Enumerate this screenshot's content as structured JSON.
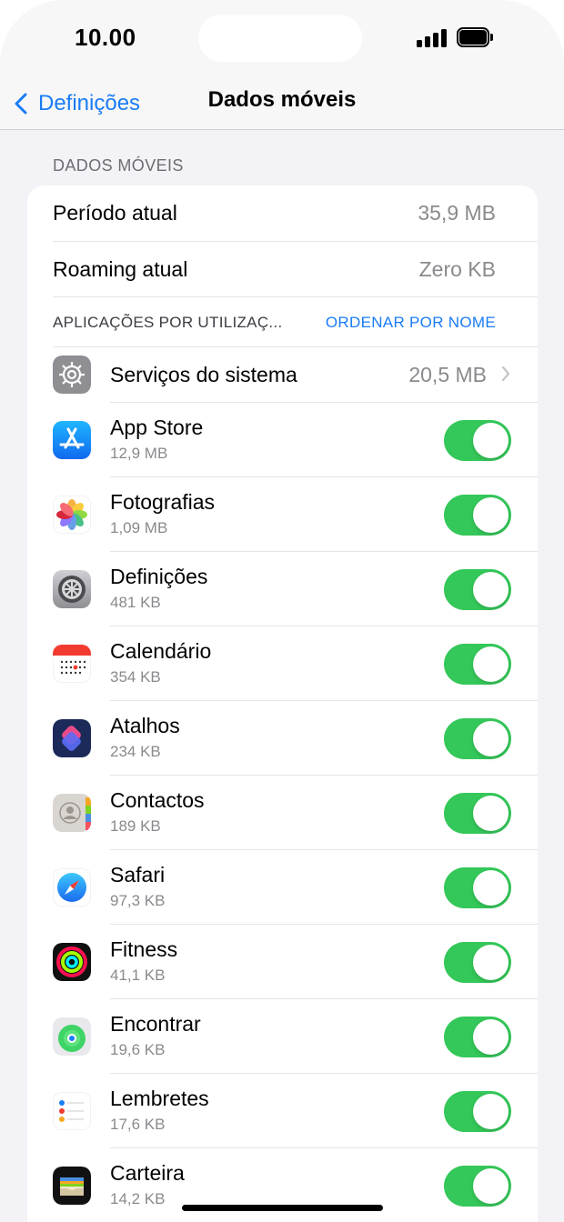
{
  "status_bar": {
    "time": "10.00"
  },
  "nav": {
    "back_label": "Definições",
    "title": "Dados móveis"
  },
  "section_header": "DADOS MÓVEIS",
  "usage": [
    {
      "label": "Período atual",
      "value": "35,9 MB"
    },
    {
      "label": "Roaming atual",
      "value": "Zero KB"
    }
  ],
  "apps_header": {
    "title": "APLICAÇÕES POR UTILIZAÇ...",
    "sort_label": "ORDENAR POR NOME"
  },
  "system_services": {
    "label": "Serviços do sistema",
    "value": "20,5 MB"
  },
  "apps": [
    {
      "name": "App Store",
      "size": "12,9 MB",
      "enabled": true,
      "icon": "app-store-icon"
    },
    {
      "name": "Fotografias",
      "size": "1,09 MB",
      "enabled": true,
      "icon": "photos-icon"
    },
    {
      "name": "Definições",
      "size": "481 KB",
      "enabled": true,
      "icon": "settings-icon"
    },
    {
      "name": "Calendário",
      "size": "354 KB",
      "enabled": true,
      "icon": "calendar-icon"
    },
    {
      "name": "Atalhos",
      "size": "234 KB",
      "enabled": true,
      "icon": "shortcuts-icon"
    },
    {
      "name": "Contactos",
      "size": "189 KB",
      "enabled": true,
      "icon": "contacts-icon"
    },
    {
      "name": "Safari",
      "size": "97,3 KB",
      "enabled": true,
      "icon": "safari-icon"
    },
    {
      "name": "Fitness",
      "size": "41,1 KB",
      "enabled": true,
      "icon": "fitness-icon"
    },
    {
      "name": "Encontrar",
      "size": "19,6 KB",
      "enabled": true,
      "icon": "find-my-icon"
    },
    {
      "name": "Lembretes",
      "size": "17,6 KB",
      "enabled": true,
      "icon": "reminders-icon"
    },
    {
      "name": "Carteira",
      "size": "14,2 KB",
      "enabled": true,
      "icon": "wallet-icon"
    }
  ],
  "colors": {
    "accent": "#1a7cf5",
    "toggle_on": "#34c759",
    "background": "#f2f2f7"
  }
}
